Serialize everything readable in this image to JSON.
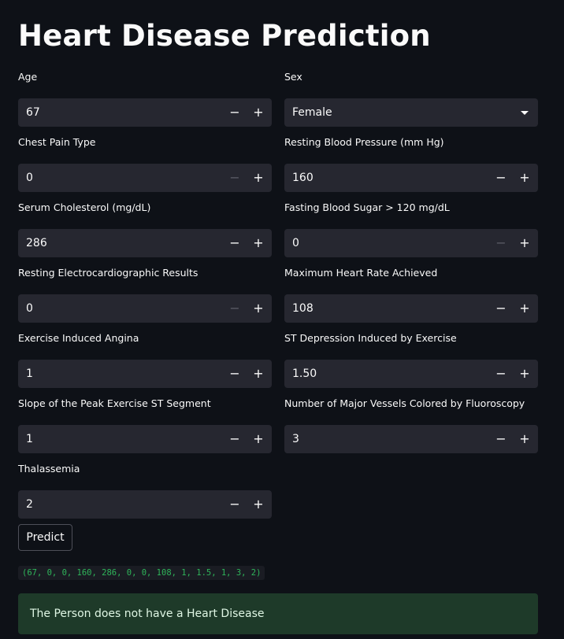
{
  "title": "Heart Disease Prediction",
  "fields": {
    "age": {
      "label": "Age",
      "value": "67"
    },
    "sex": {
      "label": "Sex",
      "value": "Female"
    },
    "cp": {
      "label": "Chest Pain Type",
      "value": "0"
    },
    "trestbps": {
      "label": "Resting Blood Pressure (mm Hg)",
      "value": "160"
    },
    "chol": {
      "label": "Serum Cholesterol (mg/dL)",
      "value": "286"
    },
    "fbs": {
      "label": "Fasting Blood Sugar > 120 mg/dL",
      "value": "0"
    },
    "restecg": {
      "label": "Resting Electrocardiographic Results",
      "value": "0"
    },
    "thalach": {
      "label": "Maximum Heart Rate Achieved",
      "value": "108"
    },
    "exang": {
      "label": "Exercise Induced Angina",
      "value": "1"
    },
    "oldpeak": {
      "label": "ST Depression Induced by Exercise",
      "value": "1.50"
    },
    "slope": {
      "label": "Slope of the Peak Exercise ST Segment",
      "value": "1"
    },
    "ca": {
      "label": "Number of Major Vessels Colored by Fluoroscopy",
      "value": "3"
    },
    "thal": {
      "label": "Thalassemia",
      "value": "2"
    }
  },
  "stepper": {
    "minus": "−",
    "plus": "+"
  },
  "predict_button": "Predict",
  "input_tuple": "(67, 0, 0, 160, 286, 0, 0, 108, 1, 1.5, 1, 3, 2)",
  "result": "The Person does not have a Heart Disease",
  "colors": {
    "background": "#0e1117",
    "input_bg": "#262730",
    "success_bg": "#1e3a29",
    "code_green": "#2fb55a"
  }
}
